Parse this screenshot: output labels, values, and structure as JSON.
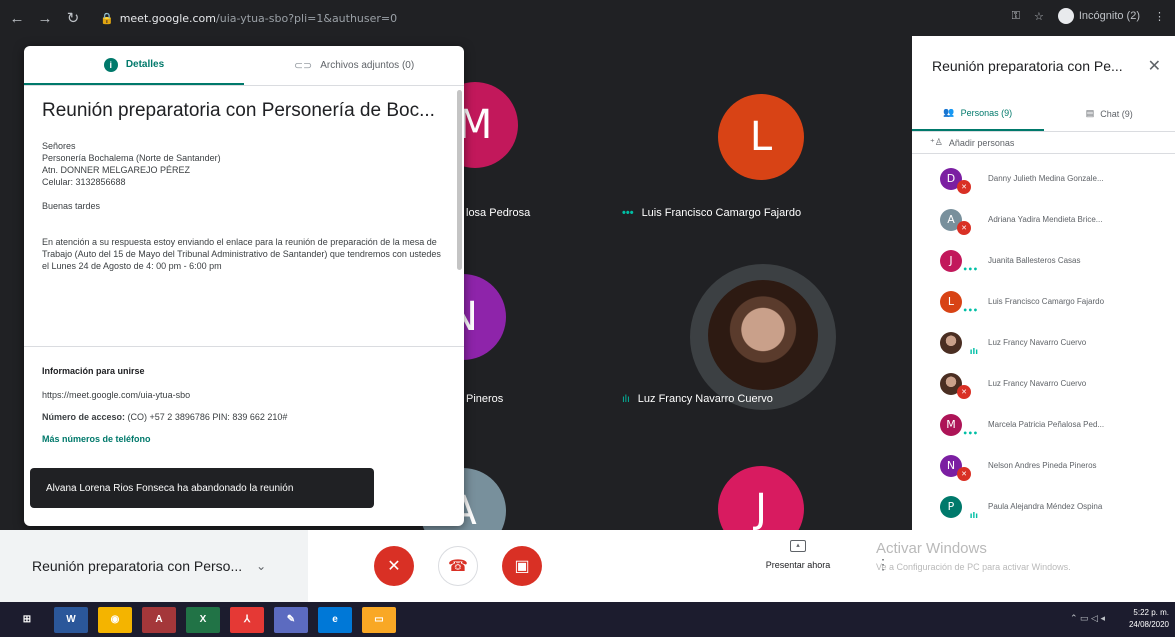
{
  "browser": {
    "url_host": "meet.google.com",
    "url_path": "/uia-ytua-sbo?pli=1&authuser=0",
    "incognito_label": "Incógnito (2)",
    "icons": [
      "back-icon",
      "forward-icon",
      "reload-icon",
      "lock-icon",
      "key-icon",
      "star-icon",
      "incognito-icon",
      "menu-icon"
    ]
  },
  "details": {
    "tabs": [
      {
        "label": "Detalles",
        "active": true
      },
      {
        "label": "Archivos adjuntos (0)",
        "active": false
      }
    ],
    "title": "Reunión preparatoria con Personería de Boc...",
    "lines": [
      "Señores",
      "Personería Bochalema  (Norte de Santander)",
      "Atn. DONNER MELGAREJO PÉREZ",
      "Celular: 3132856688"
    ],
    "greeting": "Buenas tardes",
    "paragraph": "En atención a su respuesta estoy enviando el enlace para la reunión de preparación de la mesa de Trabajo (Auto del 15 de Mayo del Tribunal Administrativo de Santander) que tendremos con ustedes el Lunes 24 de Agosto de 4: 00 pm - 6:00 pm",
    "join_heading": "Información para unirse",
    "join_link": "https://meet.google.com/uia-ytua-sbo",
    "access_label": "Número de acceso:",
    "access_value": "(CO) +57 2 3896786  PIN: 839 662 210#",
    "more_numbers": "Más números de teléfono"
  },
  "toast": "Alvana Lorena Rios Fonseca ha abandonado la reunión",
  "tiles": [
    {
      "initial": "M",
      "color": "#c2185b",
      "name": "losa Pedrosa"
    },
    {
      "initial": "L",
      "color": "#d84315",
      "name": "Luis Francisco Camargo Fajardo"
    },
    {
      "initial": "N",
      "color": "#8e24aa",
      "name": "Pineros"
    },
    {
      "initial": "",
      "color": "#3c4043",
      "name": "Luz Francy Navarro Cuervo"
    },
    {
      "initial": "A",
      "color": "#78909c",
      "name": ""
    },
    {
      "initial": "J",
      "color": "#d81b60",
      "name": ""
    }
  ],
  "bottom": {
    "meeting_name": "Reunión preparatoria con Perso...",
    "present_label": "Presentar ahora"
  },
  "watermark": {
    "line1": "Activar Windows",
    "line2": "Ve a Configuración de PC para activar Windows."
  },
  "side": {
    "title": "Reunión preparatoria con Pe...",
    "tabs": [
      {
        "label": "Personas (9)",
        "active": true
      },
      {
        "label": "Chat (9)",
        "active": false
      }
    ],
    "add_people": "Añadir personas",
    "people": [
      {
        "initial": "D",
        "color": "#7b1fa2",
        "name": "Danny Julieth Medina Gonzale...",
        "status": "muted"
      },
      {
        "initial": "A",
        "color": "#78909c",
        "name": "Adriana Yadira Mendieta Brice...",
        "status": "muted"
      },
      {
        "initial": "J",
        "color": "#c2185b",
        "name": "Juanita Ballesteros Casas",
        "status": "dots"
      },
      {
        "initial": "L",
        "color": "#d84315",
        "name": "Luis Francisco Camargo Fajardo",
        "status": "dots"
      },
      {
        "initial": "",
        "color": "photo",
        "name": "Luz Francy Navarro Cuervo",
        "status": "speaking"
      },
      {
        "initial": "",
        "color": "photo",
        "name": "Luz Francy Navarro Cuervo",
        "status": "muted"
      },
      {
        "initial": "M",
        "color": "#ad1457",
        "name": "Marcela Patricia Peñalosa Ped...",
        "status": "dots"
      },
      {
        "initial": "N",
        "color": "#7b1fa2",
        "name": "Nelson Andres Pineda Pineros",
        "status": "muted"
      },
      {
        "initial": "P",
        "color": "#00796b",
        "name": "Paula Alejandra Méndez Ospina",
        "status": "speaking"
      }
    ]
  },
  "taskbar": {
    "items": [
      {
        "icon": "windows-start-icon",
        "color": "#1c1c2e",
        "label": "⊞"
      },
      {
        "icon": "word-icon",
        "color": "#2b579a",
        "label": "W"
      },
      {
        "icon": "chrome-icon",
        "color": "#f4b400",
        "label": "◉"
      },
      {
        "icon": "access-icon",
        "color": "#a4373a",
        "label": "A"
      },
      {
        "icon": "excel-icon",
        "color": "#217346",
        "label": "X"
      },
      {
        "icon": "acrobat-icon",
        "color": "#e53935",
        "label": "⅄"
      },
      {
        "icon": "tool-icon",
        "color": "#5c6bc0",
        "label": "✎"
      },
      {
        "icon": "edge-icon",
        "color": "#0078d7",
        "label": "e"
      },
      {
        "icon": "folder-icon",
        "color": "#f9a825",
        "label": "▭"
      }
    ],
    "time": "5:22 p. m.",
    "date": "24/08/2020"
  }
}
